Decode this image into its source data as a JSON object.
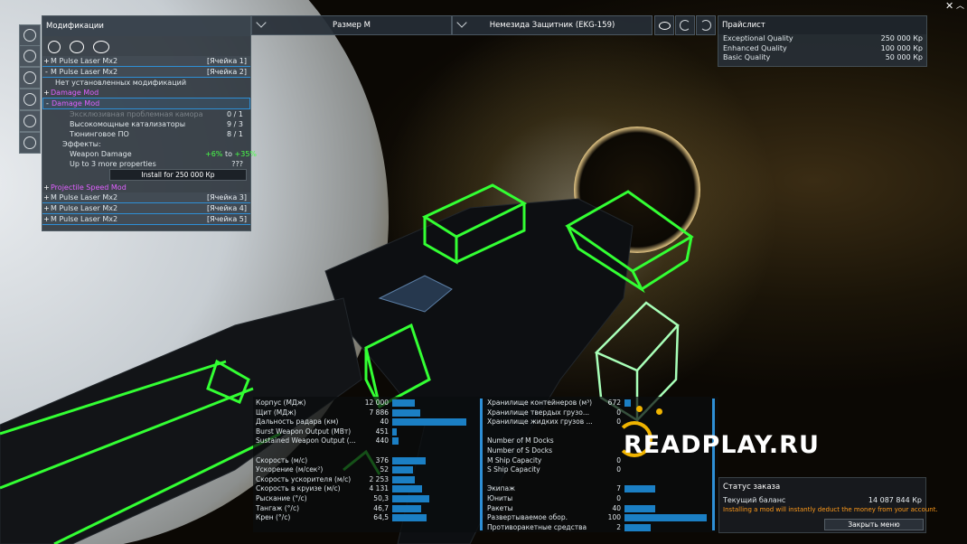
{
  "mods_panel": {
    "title": "Модификации",
    "slots": [
      {
        "toggle": "+",
        "name": "M Pulse Laser Mx2",
        "slot": "[Ячейка 1]"
      },
      {
        "toggle": "-",
        "name": "M Pulse Laser Mx2",
        "slot": "[Ячейка 2]"
      }
    ],
    "no_mods": "Нет установленных модификаций",
    "mod_a": {
      "toggle": "+",
      "name": "Damage Mod"
    },
    "mod_b": {
      "toggle": "-",
      "name": "Damage Mod"
    },
    "requirements": [
      {
        "label": "Эксклюзивная проблемная камора",
        "value": "0 / 1"
      },
      {
        "label": "Высокомощные катализаторы",
        "value": "9 / 3"
      },
      {
        "label": "Тюнинговое ПО",
        "value": "8 / 1"
      }
    ],
    "effects_label": "Эффекты:",
    "effect": {
      "label": "Weapon Damage",
      "from": "+6%",
      "to_word": "to",
      "to": "+35%"
    },
    "more": {
      "label": "Up to 3 more properties",
      "value": "???"
    },
    "install_button": "Install for 250 000 Кр",
    "mod_c": {
      "toggle": "+",
      "name": "Projectile Speed Mod"
    },
    "other_slots": [
      {
        "toggle": "+",
        "name": "M Pulse Laser Mx2",
        "slot": "[Ячейка 3]"
      },
      {
        "toggle": "+",
        "name": "M Pulse Laser Mx2",
        "slot": "[Ячейка 4]"
      },
      {
        "toggle": "+",
        "name": "M Pulse Laser Mx2",
        "slot": "[Ячейка 5]"
      }
    ]
  },
  "selectors": {
    "size": "Размер М",
    "ship": "Немезида Защитник (EKG-159)"
  },
  "pricelist": {
    "title": "Прайслист",
    "rows": [
      {
        "label": "Exceptional Quality",
        "value": "250 000 Кр"
      },
      {
        "label": "Enhanced Quality",
        "value": "100 000 Кр"
      },
      {
        "label": "Basic Quality",
        "value": "50 000 Кр"
      }
    ]
  },
  "stats_left": [
    {
      "label": "Корпус (МДж)",
      "value": "12 000",
      "fill": 0.3
    },
    {
      "label": "Щит (МДж)",
      "value": "7 886",
      "fill": 0.37
    },
    {
      "label": "Дальность радара (км)",
      "value": "40",
      "fill": 0.98
    },
    {
      "label": "Burst Weapon Output (МВт)",
      "value": "451",
      "fill": 0.06
    },
    {
      "label": "Sustained Weapon Output (...",
      "value": "440",
      "fill": 0.08
    },
    {
      "label": "",
      "value": "",
      "fill": 0
    },
    {
      "label": "Скорость (м/с)",
      "value": "376",
      "fill": 0.44
    },
    {
      "label": "Ускорение (м/сек²)",
      "value": "52",
      "fill": 0.27
    },
    {
      "label": "Скорость ускорителя (м/с)",
      "value": "2 253",
      "fill": 0.3
    },
    {
      "label": "Скорость в круизе (м/с)",
      "value": "4 131",
      "fill": 0.39
    },
    {
      "label": "Рыскание (°/с)",
      "value": "50,3",
      "fill": 0.49
    },
    {
      "label": "Тангаж (°/с)",
      "value": "46,7",
      "fill": 0.38
    },
    {
      "label": "Крен (°/с)",
      "value": "64,5",
      "fill": 0.45
    }
  ],
  "stats_right": [
    {
      "label": "Хранилище контейнеров (м³)",
      "value": "672",
      "fill": 0.07
    },
    {
      "label": "Хранилище твердых грузо...",
      "value": "0",
      "fill": 0
    },
    {
      "label": "Хранилище жидких грузов ...",
      "value": "0",
      "fill": 0
    },
    {
      "label": "",
      "value": "",
      "fill": 0
    },
    {
      "label": "Number of M Docks",
      "value": "",
      "fill": 0
    },
    {
      "label": "Number of S Docks",
      "value": "",
      "fill": 0
    },
    {
      "label": "M Ship Capacity",
      "value": "0",
      "fill": 0
    },
    {
      "label": "S Ship Capacity",
      "value": "0",
      "fill": 0
    },
    {
      "label": "",
      "value": "",
      "fill": 0
    },
    {
      "label": "Экипаж",
      "value": "7",
      "fill": 0.35
    },
    {
      "label": "Юниты",
      "value": "0",
      "fill": 0
    },
    {
      "label": "Ракеты",
      "value": "40",
      "fill": 0.35
    },
    {
      "label": "Развертываемое обор.",
      "value": "100",
      "fill": 0.95
    },
    {
      "label": "Противоракетные средства",
      "value": "2",
      "fill": 0.3
    }
  ],
  "order": {
    "title": "Статус заказа",
    "balance_label": "Текущий баланс",
    "balance_value": "14 087 844 Кр",
    "warning": "Installing a mod will instantly deduct the money from your account.",
    "close_button": "Закрыть меню"
  },
  "watermark": "READPLAY.RU",
  "colors": {
    "accent": "#2e8fd6",
    "wireframe": "#33ff33",
    "mod_name": "#e060ff",
    "warning": "#ff9a1a"
  }
}
